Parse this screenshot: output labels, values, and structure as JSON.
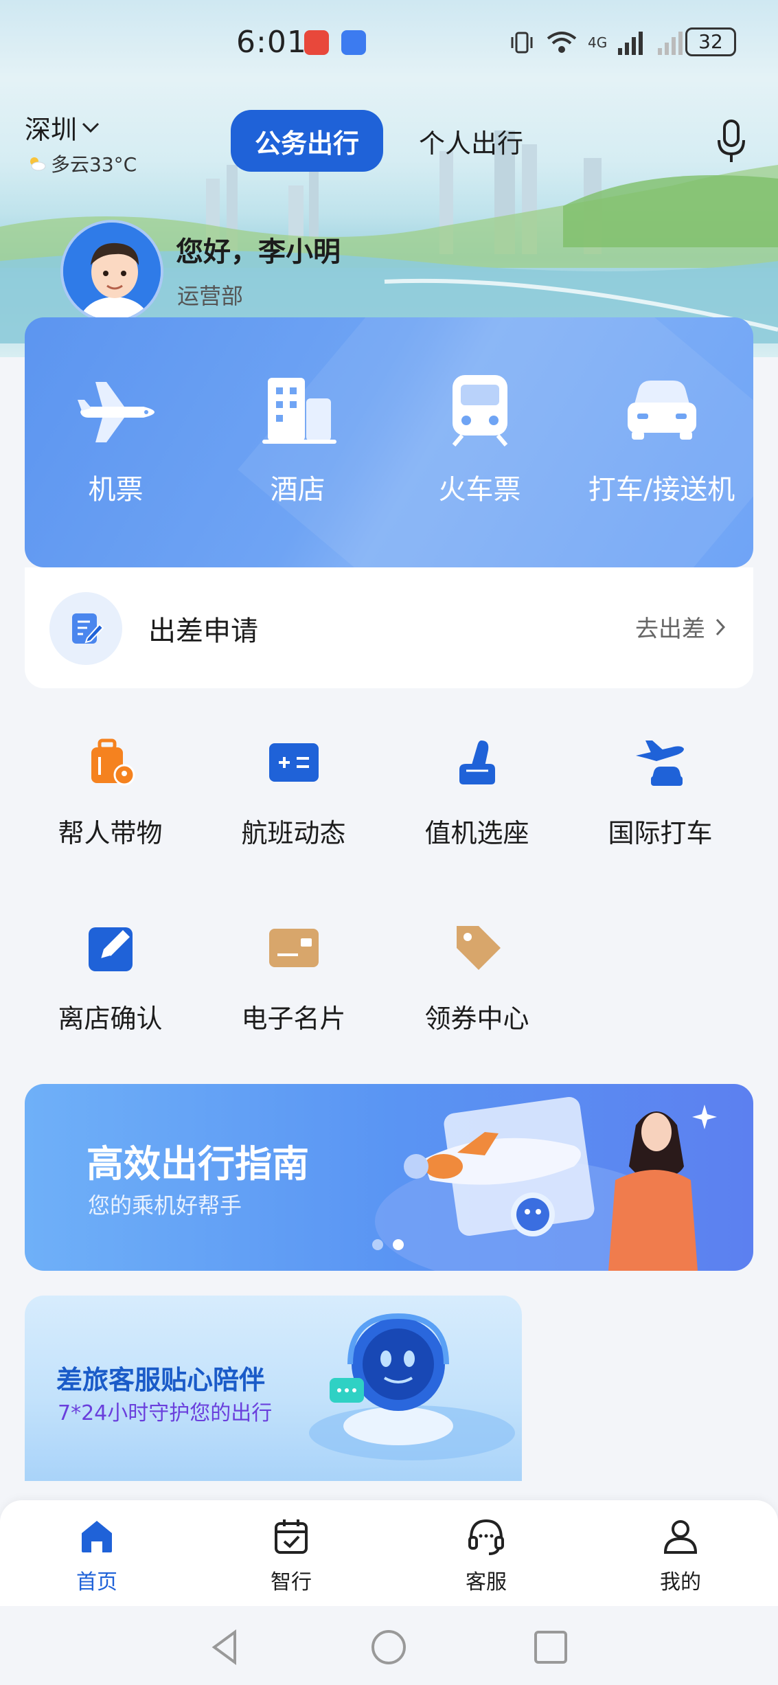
{
  "status_bar": {
    "time": "6:01",
    "battery": "32",
    "network": "4G"
  },
  "header": {
    "city": "深圳",
    "weather": "多云33°C",
    "tabs": [
      {
        "label": "公务出行",
        "active": true
      },
      {
        "label": "个人出行",
        "active": false
      }
    ]
  },
  "user": {
    "greeting": "您好，李小明",
    "department": "运营部"
  },
  "main_services": [
    {
      "label": "机票",
      "icon": "plane-icon"
    },
    {
      "label": "酒店",
      "icon": "hotel-icon"
    },
    {
      "label": "火车票",
      "icon": "train-icon"
    },
    {
      "label": "打车/接送机",
      "icon": "car-icon"
    }
  ],
  "trip": {
    "title": "出差申请",
    "link": "去出差"
  },
  "services": [
    {
      "label": "帮人带物",
      "icon": "luggage-icon",
      "color": "#f5821f"
    },
    {
      "label": "航班动态",
      "icon": "flight-status-icon",
      "color": "#1f62d8"
    },
    {
      "label": "值机选座",
      "icon": "seat-icon",
      "color": "#1f62d8"
    },
    {
      "label": "国际打车",
      "icon": "intl-taxi-icon",
      "color": "#1f62d8"
    },
    {
      "label": "离店确认",
      "icon": "checkout-icon",
      "color": "#1f62d8"
    },
    {
      "label": "电子名片",
      "icon": "card-icon",
      "color": "#d8a66b"
    },
    {
      "label": "领券中心",
      "icon": "coupon-icon",
      "color": "#d8a66b"
    }
  ],
  "banner1": {
    "title": "高效出行指南",
    "subtitle": "您的乘机好帮手"
  },
  "banner2": {
    "title": "差旅客服贴心陪伴",
    "subtitle": "7*24小时守护您的出行"
  },
  "bottom_nav": [
    {
      "label": "首页",
      "active": true
    },
    {
      "label": "智行",
      "active": false
    },
    {
      "label": "客服",
      "active": false
    },
    {
      "label": "我的",
      "active": false
    }
  ],
  "colors": {
    "primary": "#1f62d8",
    "card": "#6a9ff3",
    "orange": "#f5821f",
    "gold": "#d8a66b"
  }
}
